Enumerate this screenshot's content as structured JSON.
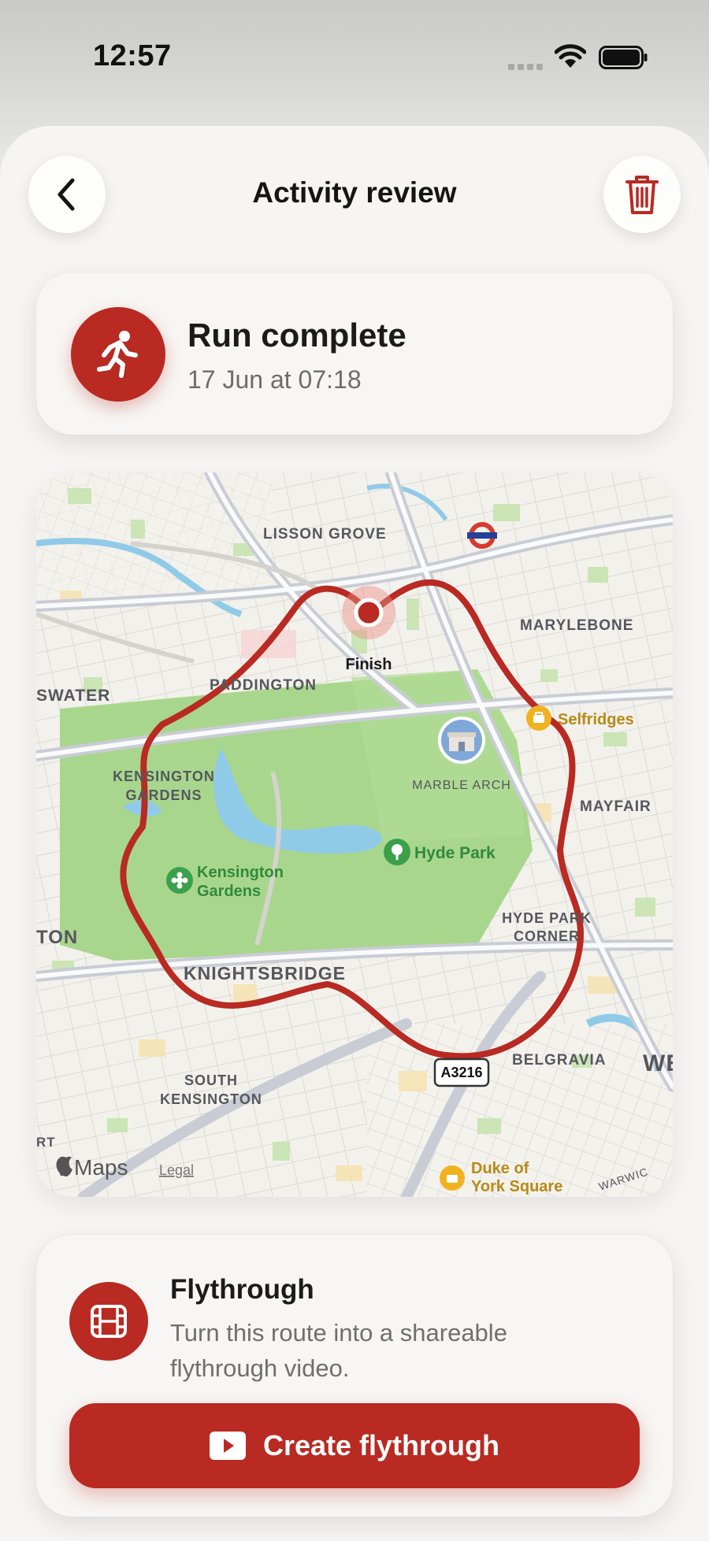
{
  "status_bar": {
    "time": "12:57"
  },
  "header": {
    "title": "Activity review",
    "back_icon": "chevron-left-icon",
    "delete_icon": "trash-icon"
  },
  "summary": {
    "title": "Run complete",
    "subtitle": "17 Jun at 07:18",
    "icon": "running-person-icon"
  },
  "map": {
    "labels": {
      "lisson_grove": "LISSON GROVE",
      "marylebone": "MARYLEBONE",
      "paddington": "PADDINGTON",
      "bayswater": "SWATER",
      "kensington_gardens_area_1": "KENSINGTON",
      "kensington_gardens_area_2": "GARDENS",
      "marble_arch": "MARBLE ARCH",
      "mayfair": "MAYFAIR",
      "hyde_park": "Hyde Park",
      "kensington_gardens_poi_1": "Kensington",
      "kensington_gardens_poi_2": "Gardens",
      "selfridges": "Selfridges",
      "ton": "TON",
      "hyde_park_corner_1": "HYDE PARK",
      "hyde_park_corner_2": "CORNER",
      "knightsbridge": "KNIGHTSBRIDGE",
      "road_sign": "A3216",
      "belgravia": "BELGRAVIA",
      "we": "WE",
      "south_kensington_1": "SOUTH",
      "south_kensington_2": "KENSINGTON",
      "rt": "RT",
      "duke_of_york_1": "Duke of",
      "duke_of_york_2": "York Square",
      "warwick": "WARWIC",
      "finish": "Finish",
      "attribution": "Maps",
      "legal": "Legal"
    },
    "colors": {
      "route": "#b82a22",
      "park": "#a9d68d",
      "water": "#8fcbe8"
    }
  },
  "flythrough": {
    "title": "Flythrough",
    "description": "Turn this route into a shareable flythrough video.",
    "button_label": "Create flythrough",
    "icon": "film-icon",
    "button_icon": "play-icon"
  },
  "colors": {
    "accent": "#b82a22",
    "background": "#f6f5f3"
  }
}
